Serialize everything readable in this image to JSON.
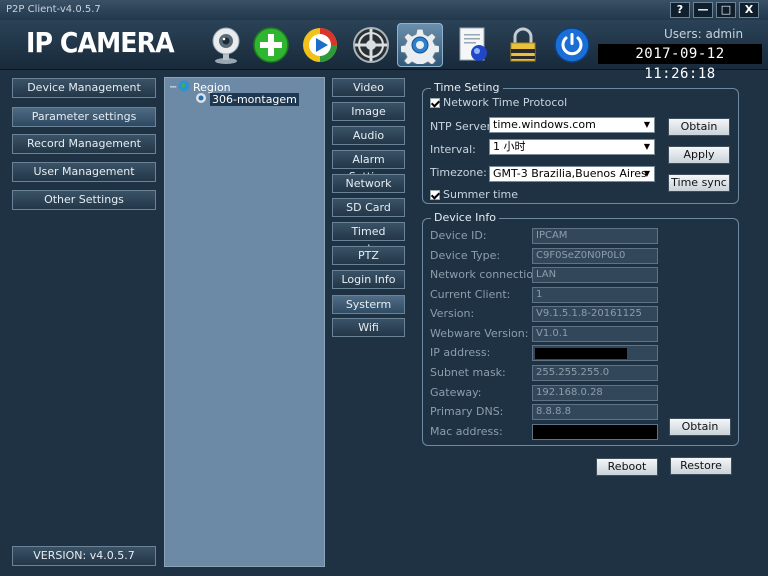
{
  "window": {
    "title": "P2P Client-v4.0.5.7",
    "controls": {
      "help": "?",
      "minimize": "—",
      "maximize": "□",
      "close": "X"
    }
  },
  "header": {
    "logo": "IP CAMERA",
    "users": "Users: admin",
    "clock": "2017-09-12 11:26:18",
    "toolbar": [
      {
        "name": "webcam-icon"
      },
      {
        "name": "add-icon"
      },
      {
        "name": "playback-icon"
      },
      {
        "name": "ptz-wheel-icon"
      },
      {
        "name": "settings-gear-icon",
        "active": true
      },
      {
        "name": "log-document-icon"
      },
      {
        "name": "lock-icon"
      },
      {
        "name": "power-icon"
      }
    ]
  },
  "nav": {
    "items": [
      {
        "label": "Device Management"
      },
      {
        "label": "Parameter settings",
        "selected": true
      },
      {
        "label": "Record Management"
      },
      {
        "label": "User Management"
      },
      {
        "label": "Other Settings"
      }
    ],
    "version": "VERSION: v4.0.5.7"
  },
  "tree": {
    "toggle": "−",
    "root": "Region",
    "child": "306-montagem"
  },
  "submenu": [
    {
      "label": "Video"
    },
    {
      "label": "Image"
    },
    {
      "label": "Audio"
    },
    {
      "label": "Alarm Setting"
    },
    {
      "label": "Network"
    },
    {
      "label": "SD Card"
    },
    {
      "label": "Timed capture"
    },
    {
      "label": "PTZ"
    },
    {
      "label": "Login Info"
    },
    {
      "label": "Systerm",
      "selected": true
    },
    {
      "label": "Wifi"
    }
  ],
  "time_setting": {
    "title": "Time Seting",
    "ntp_checkbox": "Network Time Protocol",
    "ntp_server_label": "NTP Server:",
    "ntp_server_value": "time.windows.com",
    "interval_label": "Interval:",
    "interval_value": "1 小时",
    "timezone_label": "Timezone:",
    "timezone_value": "GMT-3  Brazilia,Buenos Aires",
    "summer_checkbox": "Summer time",
    "obtain_button": "Obtain",
    "apply_button": "Apply",
    "time_sync_button": "Time sync"
  },
  "device_info": {
    "title": "Device Info",
    "rows": [
      {
        "label": "Device ID:",
        "value": "IPCAM"
      },
      {
        "label": "Device Type:",
        "value": "C9F0SeZ0N0P0L0"
      },
      {
        "label": "Network connection:",
        "value": "LAN"
      },
      {
        "label": "Current Client:",
        "value": "1"
      },
      {
        "label": "Version:",
        "value": "V9.1.5.1.8-20161125"
      },
      {
        "label": "Webware Version:",
        "value": "V1.0.1"
      },
      {
        "label": "IP address:",
        "value": ""
      },
      {
        "label": "Subnet mask:",
        "value": "255.255.255.0"
      },
      {
        "label": "Gateway:",
        "value": "192.168.0.28"
      },
      {
        "label": "Primary DNS:",
        "value": "8.8.8.8"
      },
      {
        "label": "Mac address:",
        "value": ""
      }
    ],
    "obtain_button": "Obtain"
  },
  "footer": {
    "reboot_button": "Reboot",
    "restore_button": "Restore"
  },
  "colors": {
    "background": "#1f3244",
    "tree_panel": "#6c8aa6",
    "add_green": "#2fb52f",
    "power_blue": "#1a6fd6"
  }
}
